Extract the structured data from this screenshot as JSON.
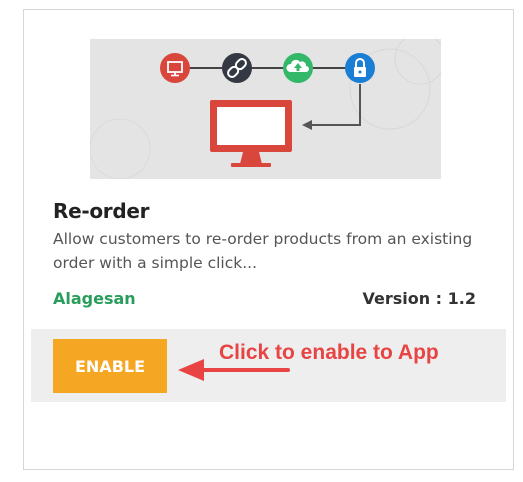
{
  "app": {
    "title": "Re-order",
    "description": "Allow customers to re-order products from an existing order with a simple click...",
    "author": "Alagesan",
    "version": "Version : 1.2"
  },
  "action": {
    "enable_label": "ENABLE"
  },
  "annotation": {
    "text": "Click to enable to App"
  },
  "banner": {
    "icons": [
      "desktop-icon",
      "link-icon",
      "cloud-upload-icon",
      "lock-icon",
      "monitor-icon"
    ],
    "colors": {
      "red": "#d9463b",
      "dark": "#333842",
      "green": "#33b86a",
      "blue": "#1a7fd4",
      "background": "#e4e4e4"
    }
  },
  "colors": {
    "accent": "#f5a623",
    "author": "#2a9d5c",
    "annotation": "#e84444"
  }
}
